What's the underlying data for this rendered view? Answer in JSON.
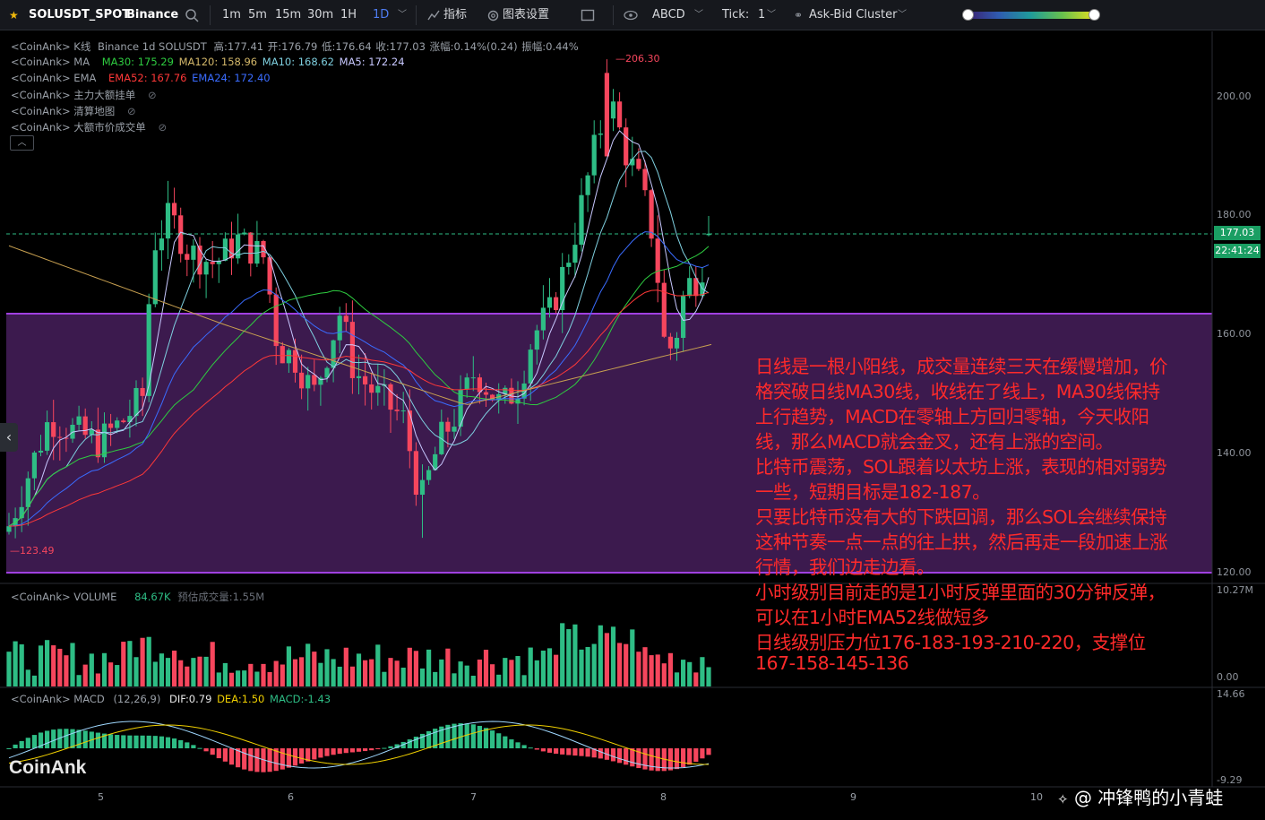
{
  "toolbar": {
    "symbol": "SOLUSDT_SPOT",
    "exchange": "Binance",
    "intervals": [
      "1m",
      "5m",
      "15m",
      "30m",
      "1H",
      "1D"
    ],
    "active_interval": "1D",
    "indicators_label": "指标",
    "chart_settings_label": "图表设置",
    "drawing_label": "ABCD",
    "tick_label": "Tick:",
    "tick_value": "1",
    "cluster_label": "Ask-Bid Cluster"
  },
  "legend": {
    "kline": {
      "source": "<CoinAnk>",
      "name": "K线",
      "pair": "Binance 1d SOLUSDT",
      "high": "高:177.41",
      "open": "开:176.79",
      "low": "低:176.64",
      "close": "收:177.03",
      "change": "涨幅:0.14%(0.24)",
      "amplitude": "振幅:0.44%"
    },
    "ma": {
      "source": "<CoinAnk>",
      "name": "MA",
      "ma30": "MA30: 175.29",
      "ma120": "MA120: 158.96",
      "ma10": "MA10: 168.62",
      "ma5": "MA5: 172.24"
    },
    "ema": {
      "source": "<CoinAnk>",
      "name": "EMA",
      "ema52": "EMA52: 167.76",
      "ema24": "EMA24: 172.40"
    },
    "extra": [
      {
        "source": "<CoinAnk>",
        "name": "主力大额挂单"
      },
      {
        "source": "<CoinAnk>",
        "name": "清算地图"
      },
      {
        "source": "<CoinAnk>",
        "name": "大额市价成交单"
      }
    ],
    "volume": {
      "source": "<CoinAnk>",
      "name": "VOLUME",
      "value": "84.67K",
      "estimate": "预估成交量:1.55M"
    },
    "macd": {
      "source": "<CoinAnk>",
      "name": "MACD",
      "params": "(12,26,9)",
      "dif": "DIF:0.79",
      "dea": "DEA:1.50",
      "macd": "MACD:-1.43"
    }
  },
  "price_axis": [
    "200.00",
    "180.00",
    "160.00",
    "140.00",
    "120.00"
  ],
  "volume_axis": [
    "10.27M",
    "0.00"
  ],
  "macd_axis": [
    "14.66",
    "-9.29"
  ],
  "time_axis": [
    "5",
    "6",
    "7",
    "8",
    "9",
    "10"
  ],
  "current_price": "177.03",
  "countdown": "22:41:24",
  "high_marker": "206.30",
  "low_marker": "123.49",
  "watermark": "CoinAnk",
  "author": "@ 冲锋鸭的小青蛙",
  "notes": [
    "日线是一根小阳线，成交量连续三天在缓慢增加，价",
    "格突破日线MA30线，收线在了线上，MA30线保持",
    "上行趋势，MACD在零轴上方回归零轴，今天收阳",
    "线，那么MACD就会金叉，还有上涨的空间。",
    "比特币震荡，SOL跟着以太坊上涨，表现的相对弱势",
    "一些，短期目标是182-187。",
    "只要比特币没有大的下跌回调，那么SOL会继续保持",
    "这种节奏一点一点的往上拱，然后再走一段加速上涨",
    "行情，我们边走边看。",
    "小时级别目前走的是1小时反弹里面的30分钟反弹，",
    "可以在1小时EMA52线做短多",
    "日线级别压力位176-183-193-210-220，支撑位",
    "167-158-145-136"
  ],
  "colors": {
    "up": "#2ebd85",
    "down": "#f6465d",
    "zone": "#3a1a4a",
    "zone_border": "#a040e0",
    "note": "#ff2a2a",
    "price_tag": "#1a9e63"
  },
  "chart_data": {
    "type": "candlestick",
    "title": "Binance 1d SOLUSDT",
    "ylim": [
      115,
      210
    ],
    "x_ticks": [
      "5",
      "6",
      "7",
      "8",
      "9",
      "10"
    ],
    "last": {
      "open": 176.79,
      "high": 177.41,
      "low": 176.64,
      "close": 177.03
    },
    "high": 206.3,
    "low": 123.49,
    "zone": [
      120,
      163
    ],
    "indicators": {
      "MA30": 175.29,
      "MA120": 158.96,
      "MA10": 168.62,
      "MA5": 172.24,
      "EMA52": 167.76,
      "EMA24": 172.4,
      "DIF": 0.79,
      "DEA": 1.5,
      "MACD": -1.43
    },
    "volume_range": [
      0,
      10.27
    ],
    "macd_range": [
      -9.29,
      14.66
    ]
  }
}
